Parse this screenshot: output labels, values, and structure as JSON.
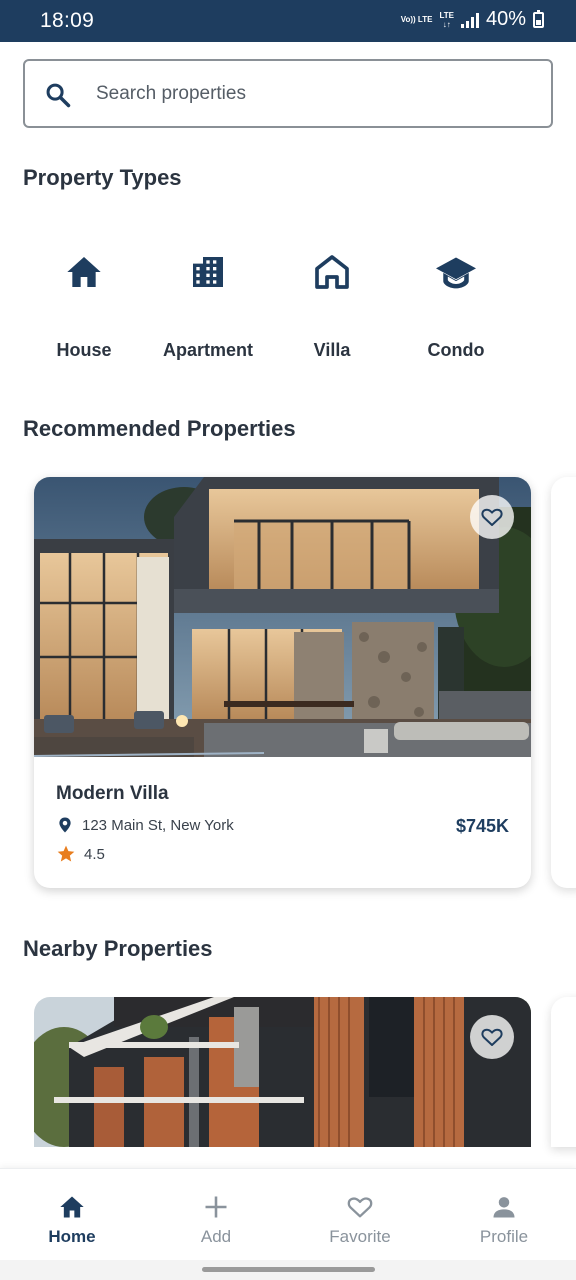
{
  "status_bar": {
    "time": "18:09",
    "network_top": "Vo)) LTE",
    "network_lte": "LTE",
    "battery": "40%"
  },
  "search": {
    "placeholder": "Search properties",
    "icon": "search-icon"
  },
  "property_types": {
    "title": "Property Types",
    "items": [
      {
        "label": "House",
        "icon": "house-icon"
      },
      {
        "label": "Apartment",
        "icon": "apartment-building-icon"
      },
      {
        "label": "Villa",
        "icon": "villa-outline-icon"
      },
      {
        "label": "Condo",
        "icon": "graduation-cap-icon"
      }
    ]
  },
  "recommended": {
    "title": "Recommended Properties",
    "card": {
      "name": "Modern Villa",
      "address": "123 Main St, New York",
      "price": "$745K",
      "rating": "4.5"
    }
  },
  "nearby": {
    "title": "Nearby Properties"
  },
  "bottom_nav": {
    "items": [
      {
        "label": "Home",
        "icon": "home-icon",
        "active": true
      },
      {
        "label": "Add",
        "icon": "plus-icon",
        "active": false
      },
      {
        "label": "Favorite",
        "icon": "heart-icon",
        "active": false
      },
      {
        "label": "Profile",
        "icon": "person-icon",
        "active": false
      }
    ]
  },
  "colors": {
    "primary": "#1e3d5f",
    "star": "#e87d1e",
    "text": "#2b3440",
    "inactive": "#8a939c"
  }
}
